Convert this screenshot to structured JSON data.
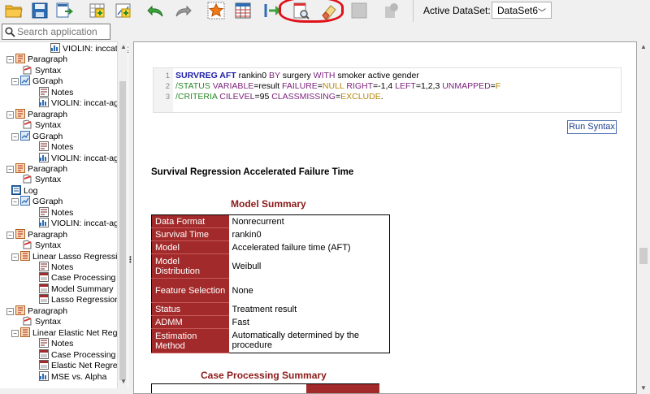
{
  "toolbar": {
    "icons": [
      "open-folder-icon",
      "save-icon",
      "export-icon",
      "add-table-icon",
      "add-chart-icon",
      "undo-icon",
      "redo-icon",
      "star-icon",
      "table-icon",
      "goto-icon",
      "print-preview-icon",
      "eraser-icon",
      "disabled-square-icon",
      "disabled-shape-icon"
    ],
    "active_dataset_label": "Active DataSet:",
    "active_dataset_value": "DataSet6"
  },
  "search": {
    "placeholder": "Search application"
  },
  "tree": {
    "rows": [
      {
        "label": "VIOLIN: inccat-age"
      },
      {
        "label": "Paragraph"
      },
      {
        "label": "Syntax"
      },
      {
        "label": "GGraph"
      },
      {
        "label": "Notes"
      },
      {
        "label": "VIOLIN: inccat-age"
      },
      {
        "label": "Paragraph"
      },
      {
        "label": "Syntax"
      },
      {
        "label": "GGraph"
      },
      {
        "label": "Notes"
      },
      {
        "label": "VIOLIN: inccat-age"
      },
      {
        "label": "Paragraph"
      },
      {
        "label": "Syntax"
      },
      {
        "label": "Log"
      },
      {
        "label": "GGraph"
      },
      {
        "label": "Notes"
      },
      {
        "label": "VIOLIN: inccat-age"
      },
      {
        "label": "Paragraph"
      },
      {
        "label": "Syntax"
      },
      {
        "label": "Linear Lasso Regressi"
      },
      {
        "label": "Notes"
      },
      {
        "label": "Case Processing S"
      },
      {
        "label": "Model Summary"
      },
      {
        "label": "Lasso Regression"
      },
      {
        "label": "Paragraph"
      },
      {
        "label": "Syntax"
      },
      {
        "label": "Linear Elastic Net Regr"
      },
      {
        "label": "Notes"
      },
      {
        "label": "Case Processing S"
      },
      {
        "label": "Elastic Net Regres"
      },
      {
        "label": "MSE vs. Alpha"
      }
    ]
  },
  "syntax": {
    "line_numbers": [
      "1",
      "2",
      "3"
    ],
    "line1": {
      "cmd": "SURVREG AFT",
      "a": " rankin0 ",
      "by": "BY",
      "b": " surgery ",
      "with": "WITH",
      "c": " smoker active gender"
    },
    "line2": {
      "sub": "/STATUS",
      "a": " ",
      "kw1": "VARIABLE",
      "b": "=result ",
      "kw2": "FAILURE",
      "c": "=",
      "v1": "NULL",
      "d": " ",
      "kw3": "RIGHT",
      "e": "=-1,4 ",
      "kw4": "LEFT",
      "f": "=1,2,3 ",
      "kw5": "UNMAPPED",
      "g": "=",
      "v2": "F"
    },
    "line3": {
      "sub": "/CRITERIA",
      "a": " ",
      "kw1": "CILEVEL",
      "b": "=95 ",
      "kw2": "CLASSMISSING",
      "c": "=",
      "v1": "EXCLUDE",
      "d": "."
    }
  },
  "run_button": "Run Syntax",
  "section_title": "Survival Regression Accelerated Failure Time",
  "model_summary": {
    "caption": "Model Summary",
    "rows": [
      {
        "key": "Data Format",
        "value": "Nonrecurrent"
      },
      {
        "key": "Survival Time",
        "value": "rankin0"
      },
      {
        "key": "Model",
        "value": "Accelerated failure time (AFT)"
      },
      {
        "key": "Model Distribution",
        "value": "Weibull"
      },
      {
        "key": "Feature Selection",
        "value": "None"
      },
      {
        "key": "Status",
        "value": "Treatment result"
      },
      {
        "key": "ADMM",
        "value": "Fast"
      },
      {
        "key": "Estimation Method",
        "value": "Automatically determined by the procedure"
      }
    ]
  },
  "case_processing": {
    "caption": "Case Processing Summary"
  },
  "colors": {
    "accent_red": "#a32a2a",
    "caption_red": "#8b1a1a",
    "highlight_circle": "#e0111a"
  }
}
